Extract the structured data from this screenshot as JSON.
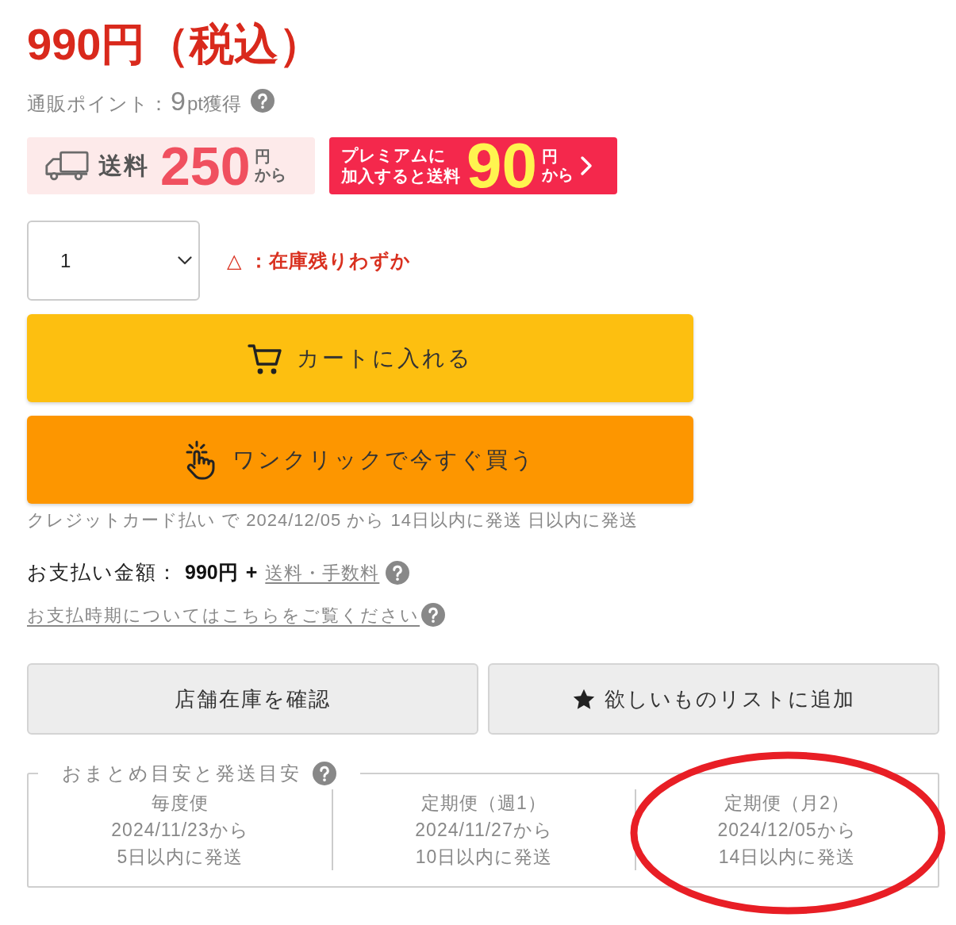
{
  "price": "990円（税込）",
  "points": {
    "label": "通販ポイント：",
    "value": "9",
    "unit": "pt獲得"
  },
  "shipping_badges": [
    {
      "kind": "standard",
      "label_lines": [
        "送料"
      ],
      "amount": "250",
      "unit": "円",
      "suffix": "から"
    },
    {
      "kind": "premium",
      "label_lines": [
        "プレミアムに",
        "加入すると送料"
      ],
      "amount": "90",
      "unit": "円",
      "suffix": "から"
    }
  ],
  "quantity": {
    "value": "1"
  },
  "stock": {
    "mark": "△",
    "text": "：在庫残りわずか"
  },
  "purchase_buttons": [
    {
      "kind": "cart",
      "label": "カートに入れる"
    },
    {
      "kind": "one_click",
      "label": "ワンクリックで今すぐ買う"
    }
  ],
  "shipping_note": "クレジットカード払い で 2024/12/05 から 14日以内に発送 日以内に発送",
  "payment": {
    "label": "お支払い金額：",
    "amount": "990円",
    "plus": "+",
    "fee_link": "送料・手数料"
  },
  "payment_timing_link": "お支払時期についてはこちらをご覧ください",
  "secondary_buttons": [
    {
      "kind": "store_stock",
      "label": "店舗在庫を確認"
    },
    {
      "kind": "wishlist",
      "label": "欲しいものリストに追加"
    }
  ],
  "delivery_estimates": {
    "title": "おまとめ目安と発送目安",
    "columns": [
      {
        "plan": "毎度便",
        "start": "2024/11/23から",
        "lead_time": "5日以内に発送",
        "circled": false
      },
      {
        "plan": "定期便（週1）",
        "start": "2024/11/27から",
        "lead_time": "10日以内に発送",
        "circled": false
      },
      {
        "plan": "定期便（月2）",
        "start": "2024/12/05から",
        "lead_time": "14日以内に発送",
        "circled": true
      }
    ]
  }
}
